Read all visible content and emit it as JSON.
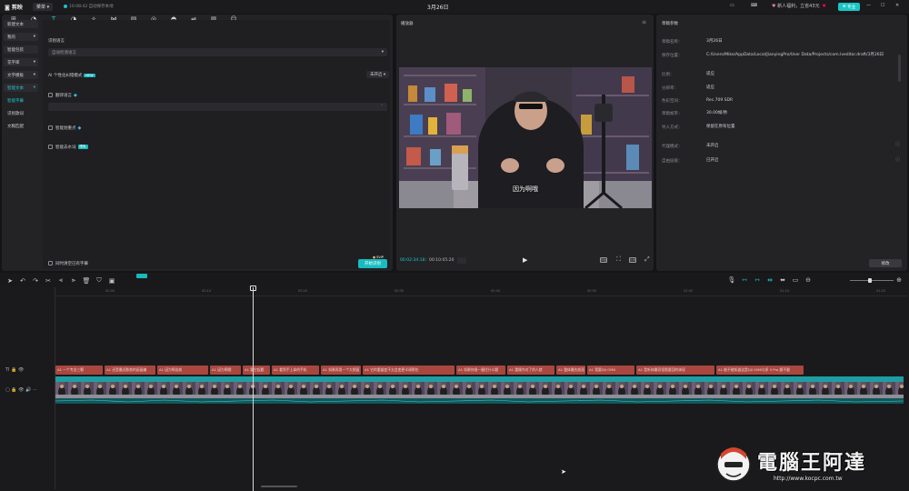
{
  "topbar": {
    "logo": "剪映",
    "menu": "菜单",
    "autosave": "10:08:42 自动保存本地",
    "title": "3月26日",
    "promo": "新人福利，立省43元",
    "pro": "专业"
  },
  "toolbar": [
    {
      "icon": "media-icon",
      "glyph": "⊞",
      "label": "素材"
    },
    {
      "icon": "audio-icon",
      "glyph": "◔",
      "label": "音频"
    },
    {
      "icon": "text-icon",
      "glyph": "T",
      "label": "文本",
      "active": true
    },
    {
      "icon": "sticker-icon",
      "glyph": "◑",
      "label": "贴纸"
    },
    {
      "icon": "effects-icon",
      "glyph": "✧",
      "label": "特效"
    },
    {
      "icon": "transition-icon",
      "glyph": "⋈",
      "label": "转场"
    },
    {
      "icon": "ai-subtitle-icon",
      "glyph": "▤",
      "label": "AI 字幕"
    },
    {
      "icon": "analysis-icon",
      "glyph": "◎",
      "label": "智能包装"
    },
    {
      "icon": "filter-icon",
      "glyph": "◓",
      "label": "滤镜"
    },
    {
      "icon": "adjust-icon",
      "glyph": "⇌",
      "label": "调节"
    },
    {
      "icon": "template-icon",
      "glyph": "▥",
      "label": "模板"
    },
    {
      "icon": "digital-human-icon",
      "glyph": "☺",
      "label": "数字人"
    }
  ],
  "sidebar": [
    {
      "label": "新建文本",
      "style": "box"
    },
    {
      "label": "我的",
      "style": "box",
      "arrow": "▾"
    },
    {
      "label": "智能包装",
      "style": "box"
    },
    {
      "label": "花字库",
      "style": "box",
      "arrow": "▾"
    },
    {
      "label": "文字模板",
      "style": "box",
      "arrow": "▾"
    },
    {
      "label": "智能文本",
      "style": "sel",
      "arrow": "▾"
    },
    {
      "label": "智能字幕",
      "style": "teal"
    },
    {
      "label": "识别歌词",
      "style": "plain"
    },
    {
      "label": "文稿匹配",
      "style": "plain"
    }
  ],
  "recognize": {
    "lang_label": "识别语言",
    "lang_value": "自动检测语言",
    "ai_mode": "AI 个性化纠错模式",
    "ai_badge": "NEW",
    "ai_toggle": "未开启",
    "translate": "翻译语言",
    "smart_split": "智能划重点",
    "filler": "智能去水词",
    "filler_badge": "限免",
    "clear_label": "同时清空已有字幕",
    "gen_button": "开始识别",
    "gen_badge": "SVIP"
  },
  "player": {
    "title": "播放器",
    "subtitle": "因为啊哦",
    "current": "00:02:34:18",
    "total": "00:10:05:20",
    "ratio": "比例",
    "full": "原始"
  },
  "draft": {
    "title": "草稿参数",
    "rows": [
      {
        "k": "草稿名称：",
        "v": "3月26日"
      },
      {
        "k": "保存位置：",
        "v": "C:/Users/Mike/AppData/Local/JianyingPro/User Data/Projects/com.lveditor.draft/3月26日"
      },
      {
        "k": "比例：",
        "v": "适应"
      },
      {
        "k": "分辨率：",
        "v": "适应"
      },
      {
        "k": "色彩空间：",
        "v": "Rec.709 SDR"
      },
      {
        "k": "草稿帧率：",
        "v": "30.00帧/秒"
      },
      {
        "k": "导入方式：",
        "v": "保留在原有位置"
      },
      {
        "k": "代理模式：",
        "v": "未开启"
      },
      {
        "k": "自由层级：",
        "v": "已开启"
      }
    ],
    "edit": "修改"
  },
  "timeline": {
    "ticks": [
      "00:00",
      "00:10",
      "00:20",
      "00:30",
      "00:40",
      "00:50",
      "01:00",
      "01:10",
      "01:20"
    ],
    "clips": [
      {
        "t": "A1 一个专业三颗",
        "w": 54
      },
      {
        "t": "A1 还是最近影前的画面编",
        "w": 58
      },
      {
        "t": "A1 因为啊出前",
        "w": 58
      },
      {
        "t": "A1 因为啊哦",
        "w": 36
      },
      {
        "t": "A1 要它起题",
        "w": 32
      },
      {
        "t": "A1 看到手上拿的手机",
        "w": 54
      },
      {
        "t": "A1 如果再用一个大侧面",
        "w": 46
      },
      {
        "t": "A1 它的重量变不太会变更半调那些",
        "w": 103
      },
      {
        "t": "A1 如果你很一握住什么题",
        "w": 56
      },
      {
        "t": "A1 重操作对了的人就",
        "w": 54
      },
      {
        "t": "A1 整体最先前面",
        "w": 34
      },
      {
        "t": "A1 我要DJI OM6",
        "w": 54
      },
      {
        "t": "A1 是听体最奇怪需要回的体现",
        "w": 88
      },
      {
        "t": "A1 能不能知道这是DJI OM6与多 3 Pro 跟不跟",
        "w": 98
      }
    ],
    "video_clip_label": "3月26日 MP4 00:10:05:20"
  },
  "watermark": {
    "brand": "電腦王阿達",
    "url": "http://www.kocpc.com.tw"
  }
}
